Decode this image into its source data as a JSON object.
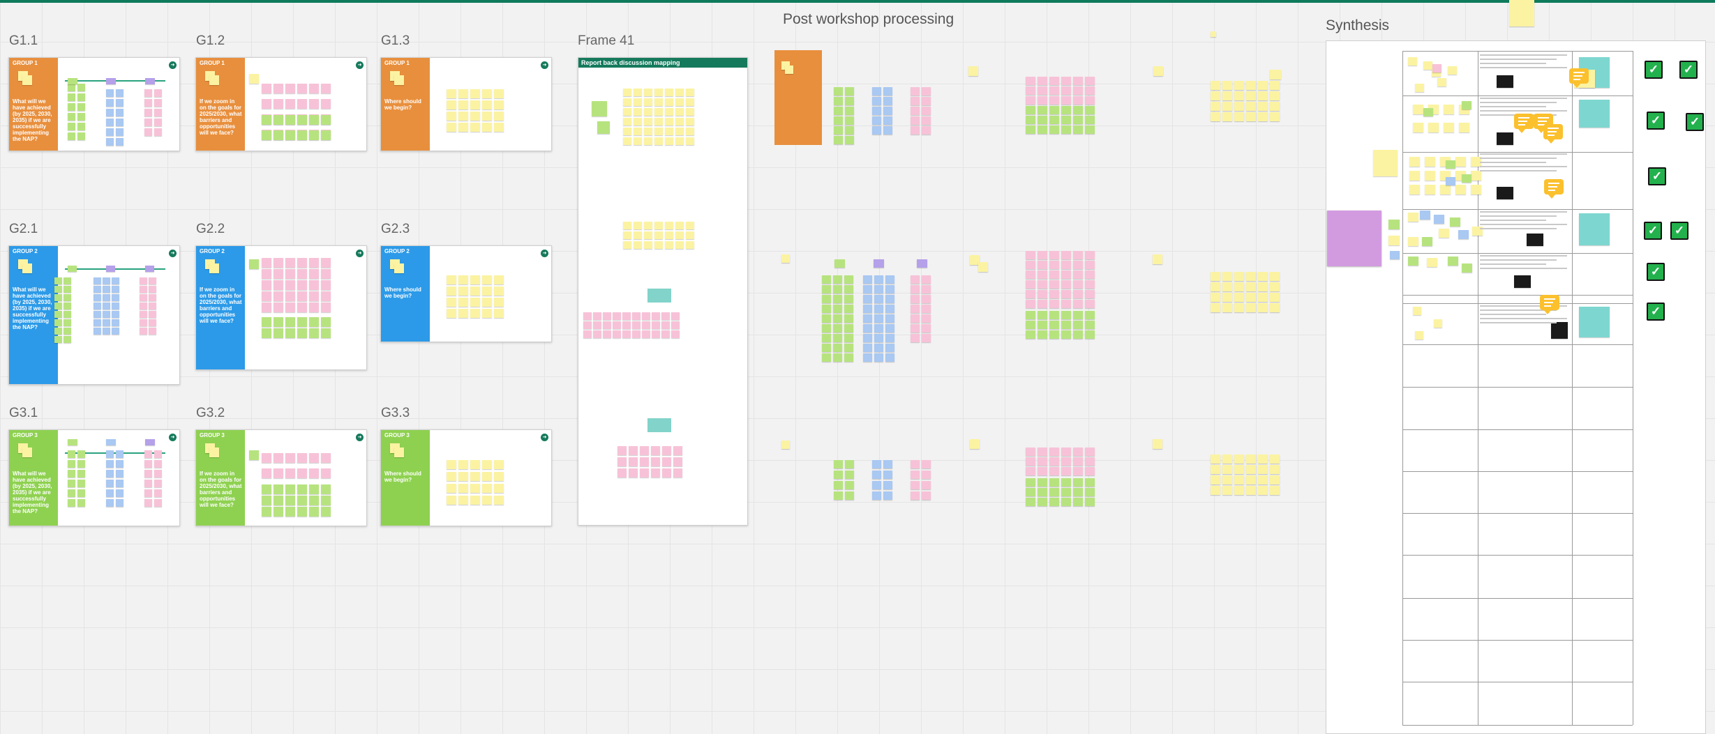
{
  "canvas": {
    "title_post": "Post workshop processing",
    "title_synthesis": "Synthesis",
    "frame41_label": "Frame 41"
  },
  "frames": [
    {
      "id": "g11",
      "label": "G1.1",
      "group": "GROUP 1",
      "q": "What will we have achieved (by 2025, 2030, 2035) if we are successfully implementing the NAP?",
      "color": "orange"
    },
    {
      "id": "g12",
      "label": "G1.2",
      "group": "GROUP 1",
      "q": "If we zoom in on the goals for 2025/2030, what barriers and opportunities will we face?",
      "color": "orange"
    },
    {
      "id": "g13",
      "label": "G1.3",
      "group": "GROUP 1",
      "q": "Where should we begin?",
      "color": "orange"
    },
    {
      "id": "g21",
      "label": "G2.1",
      "group": "GROUP 2",
      "q": "What will we have achieved (by 2025, 2030, 2035) if we are successfully implementing the NAP?",
      "color": "blue"
    },
    {
      "id": "g22",
      "label": "G2.2",
      "group": "GROUP 2",
      "q": "If we zoom in on the goals for 2025/2030, what barriers and opportunities will we face?",
      "color": "blue"
    },
    {
      "id": "g23",
      "label": "G2.3",
      "group": "GROUP 2",
      "q": "Where should we begin?",
      "color": "blue"
    },
    {
      "id": "g31",
      "label": "G3.1",
      "group": "GROUP 3",
      "q": "What will we have achieved (by 2025, 2030, 2035) if we are successfully implementing the NAP?",
      "color": "green"
    },
    {
      "id": "g32",
      "label": "G3.2",
      "group": "GROUP 3",
      "q": "If we zoom in on the goals for 2025/2030, what barriers and opportunities will we face?",
      "color": "green"
    },
    {
      "id": "g33",
      "label": "G3.3",
      "group": "GROUP 3",
      "q": "Where should we begin?",
      "color": "green"
    }
  ],
  "frame41": {
    "header": "Report back discussion mapping"
  },
  "colors": {
    "accent": "#157a5c",
    "orange": "#e88f3d",
    "blue": "#2c9ae8",
    "green": "#8ed150",
    "check": "#23b14d"
  }
}
